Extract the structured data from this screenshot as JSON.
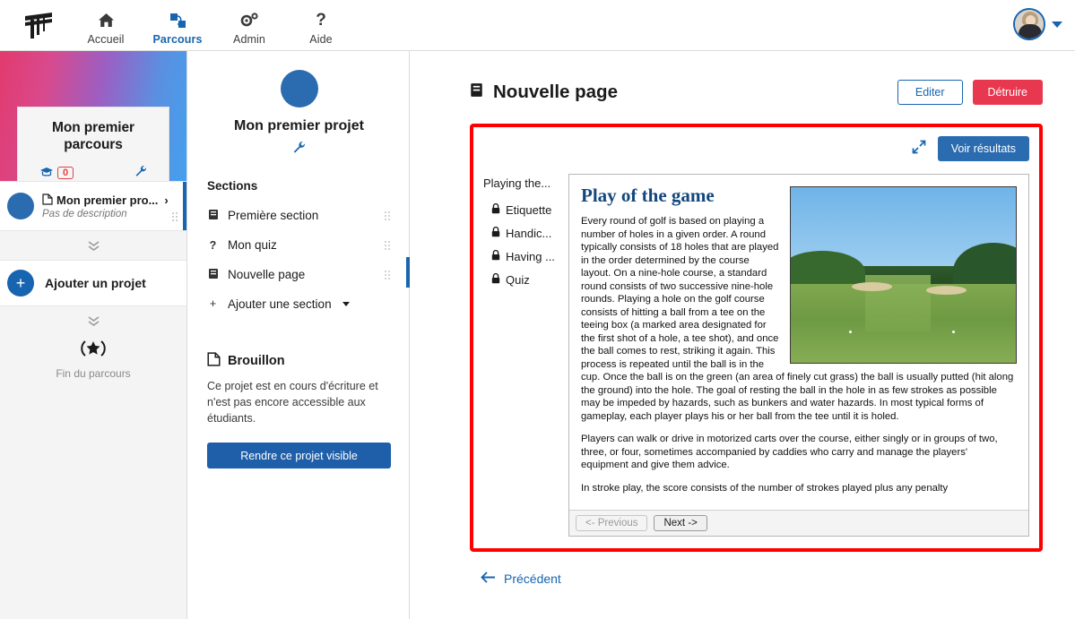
{
  "topnav": {
    "logo_icon": "logo-icon",
    "items": [
      {
        "label": "Accueil",
        "icon": "home-icon",
        "active": false
      },
      {
        "label": "Parcours",
        "icon": "path-icon",
        "active": true
      },
      {
        "label": "Admin",
        "icon": "gear-icon",
        "active": false
      },
      {
        "label": "Aide",
        "icon": "question-icon",
        "active": false
      }
    ],
    "avatar_icon": "user-avatar",
    "caret_icon": "chevron-down-icon"
  },
  "sidebar": {
    "card": {
      "title": "Mon premier parcours",
      "graduate_icon": "graduation-cap-icon",
      "count": "0",
      "wrench_icon": "wrench-icon"
    },
    "project_row": {
      "icon": "page-edit-icon",
      "title": "Mon premier pro...",
      "description": "Pas de description",
      "chevron": "›",
      "drag_handle": "drag-handle-icon"
    },
    "expand_icon": "chevron-double-down-icon",
    "add_project_label": "Ajouter un projet",
    "add_project_icon": "plus-circle-icon",
    "end_icon": "laurel-star-icon",
    "end_label": "Fin du parcours"
  },
  "sections_panel": {
    "project_title": "Mon premier projet",
    "wrench_icon": "wrench-icon",
    "heading": "Sections",
    "items": [
      {
        "label": "Première section",
        "icon": "page-icon",
        "selected": false
      },
      {
        "label": "Mon quiz",
        "icon": "question-icon",
        "selected": false
      },
      {
        "label": "Nouvelle page",
        "icon": "page-icon",
        "selected": true
      }
    ],
    "add_section_label": "Ajouter une section",
    "add_section_icon": "plus-icon",
    "draft": {
      "icon": "draft-page-icon",
      "title": "Brouillon",
      "text": "Ce projet est en cours d'écriture et n'est pas encore accessible aux étudiants.",
      "button_label": "Rendre ce projet visible"
    }
  },
  "main": {
    "page_icon": "page-icon",
    "page_title": "Nouvelle page",
    "edit_button": "Editer",
    "delete_button": "Détruire",
    "frame": {
      "expand_icon": "expand-arrows-icon",
      "results_button": "Voir résultats"
    },
    "scorm": {
      "tree_root": "Playing the...",
      "tree_items": [
        {
          "label": "Etiquette",
          "icon": "lock-icon"
        },
        {
          "label": "Handic...",
          "icon": "lock-icon"
        },
        {
          "label": "Having ...",
          "icon": "lock-icon"
        },
        {
          "label": "Quiz",
          "icon": "lock-icon"
        }
      ],
      "article_title": "Play of the game",
      "image_icon": "golf-course-photo",
      "paragraphs": [
        "Every round of golf is based on playing a number of holes in a given order. A round typically consists of 18 holes that are played in the order determined by the course layout. On a nine-hole course, a standard round consists of two successive nine-hole rounds. Playing a hole on the golf course consists of hitting a ball from a tee on the teeing box (a marked area designated for the first shot of a hole, a tee shot), and once the ball comes to rest, striking it again. This process is repeated until the ball is in the cup. Once the ball is on the green (an area of finely cut grass) the ball is usually putted (hit along the ground) into the hole. The goal of resting the ball in the hole in as few strokes as possible may be impeded by hazards, such as bunkers and water hazards. In most typical forms of gameplay, each player plays his or her ball from the tee until it is holed.",
        "Players can walk or drive in motorized carts over the course, either singly or in groups of two, three, or four, sometimes accompanied by caddies who carry and manage the players' equipment and give them advice.",
        "In stroke play, the score consists of the number of strokes played plus any penalty"
      ],
      "prev_button": "<- Previous",
      "next_button": "Next ->"
    },
    "previous_link": {
      "label": "Précédent",
      "icon": "arrow-left-icon"
    }
  },
  "colors": {
    "accent_blue": "#1765b0",
    "button_blue": "#2b6cb0",
    "danger_red": "#e8384f",
    "highlight_red": "#ff0000",
    "gradient_from": "#e23a6d",
    "gradient_to": "#44a0ef"
  }
}
